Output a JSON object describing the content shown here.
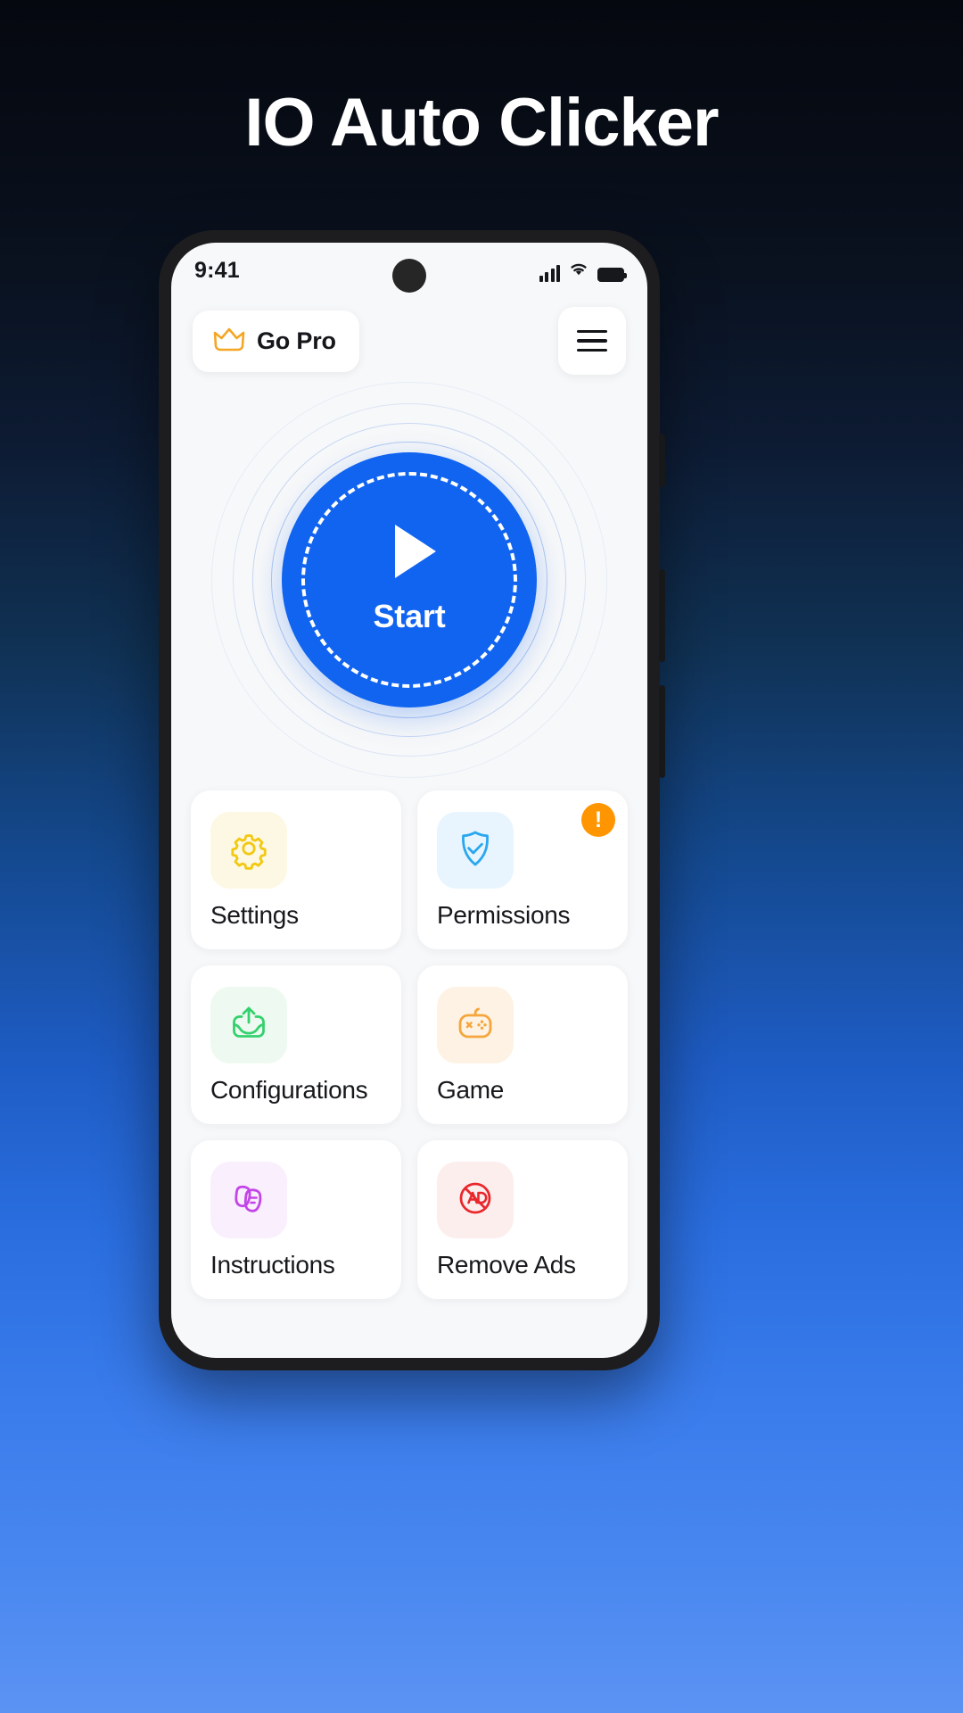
{
  "poster": {
    "title": "IO Auto Clicker",
    "background_top": "#05080f",
    "background_bottom": "#5b93f3"
  },
  "phone": {
    "status_bar": {
      "time": "9:41",
      "signal_icon": "cellular-signal-icon",
      "wifi_icon": "wifi-icon",
      "battery_icon": "battery-full-icon"
    },
    "top_bar": {
      "go_pro_label": "Go Pro",
      "go_pro_icon": "crown-icon",
      "go_pro_icon_color": "#f5a623",
      "menu_icon": "hamburger-menu-icon"
    },
    "hero": {
      "start_label": "Start",
      "play_icon": "play-triangle-icon",
      "button_color": "#1064f0",
      "ring_color": "#7aa0eb"
    },
    "tiles": [
      {
        "label": "Settings",
        "icon": "gear-icon",
        "icon_color": "#f2c811",
        "icon_bg": "#fdf8e3",
        "badge": null
      },
      {
        "label": "Permissions",
        "icon": "shield-check-icon",
        "icon_color": "#2aa7f0",
        "icon_bg": "#e8f5fe",
        "badge": "!"
      },
      {
        "label": "Configurations",
        "icon": "upload-icon",
        "icon_color": "#35d16e",
        "icon_bg": "#eefaf1",
        "badge": null
      },
      {
        "label": "Game",
        "icon": "gamepad-icon",
        "icon_color": "#f5a63d",
        "icon_bg": "#fdf2e4",
        "badge": null
      },
      {
        "label": "Instructions",
        "icon": "instructions-cards-icon",
        "icon_color": "#c345e8",
        "icon_bg": "#faeffd",
        "badge": null
      },
      {
        "label": "Remove Ads",
        "icon": "no-ads-icon",
        "icon_color": "#e8282d",
        "icon_bg": "#fdeeee",
        "badge": null
      }
    ]
  }
}
